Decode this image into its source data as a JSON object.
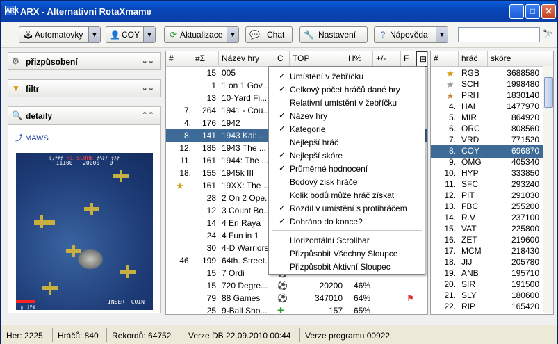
{
  "window": {
    "title": "ARX - Alternativní RotaXmame",
    "logo": "ARX"
  },
  "toolbar": {
    "automatovky": "Automatovky",
    "user": "COY",
    "aktualizace": "Aktualizace",
    "chat": "Chat",
    "nastaveni": "Nastavení",
    "napoveda": "Nápověda",
    "search_value": ""
  },
  "sidebar": {
    "prizpusobeni": "přizpůsobení",
    "filtr": "filtr",
    "detaily": "detaily",
    "maws": "MAWS",
    "screen": {
      "p1": "ﾚﾉﾁﾒﾁ",
      "hi": "HI-SCORE",
      "p2": "ﾁﾍﾚﾉ ﾁﾒﾁ",
      "s1": "11100",
      "s2": "20000",
      "s3": "0",
      "insert": "INSERT COIN",
      "bottom": "▯ ﾒﾁﾒ"
    }
  },
  "gtable": {
    "headers": [
      "#",
      "#Σ",
      "Název hry",
      "C",
      "TOP",
      "H%",
      "+/-",
      "F",
      "⊟"
    ],
    "rows": [
      {
        "rank": "",
        "total": "15",
        "name": "005",
        "top": "",
        "h": ""
      },
      {
        "rank": "",
        "total": "1",
        "name": "1 on 1 Gov...",
        "top": "",
        "h": ""
      },
      {
        "rank": "",
        "total": "13",
        "name": "10-Yard Fi...",
        "top": "",
        "h": ""
      },
      {
        "rank": "7.",
        "total": "264",
        "name": "1941 - Cou...",
        "top": "",
        "h": ""
      },
      {
        "rank": "4.",
        "total": "176",
        "name": "1942",
        "top": "",
        "h": ""
      },
      {
        "rank": "8.",
        "total": "141",
        "name": "1943 Kai: ...",
        "top": "",
        "h": ""
      },
      {
        "rank": "12.",
        "total": "185",
        "name": "1943 The ...",
        "top": "",
        "h": ""
      },
      {
        "rank": "11.",
        "total": "161",
        "name": "1944: The ...",
        "top": "",
        "h": ""
      },
      {
        "rank": "18.",
        "total": "155",
        "name": "1945k III",
        "top": "",
        "h": ""
      },
      {
        "rank": "",
        "total": "161",
        "name": "19XX: The ...",
        "top": "",
        "h": ""
      },
      {
        "rank": "",
        "total": "28",
        "name": "2 On 2 Ope...",
        "top": "",
        "h": ""
      },
      {
        "rank": "",
        "total": "12",
        "name": "3 Count Bo...",
        "top": "",
        "h": ""
      },
      {
        "rank": "",
        "total": "14",
        "name": "4 En Raya",
        "top": "",
        "h": ""
      },
      {
        "rank": "",
        "total": "24",
        "name": "4 Fun in 1",
        "top": "",
        "h": ""
      },
      {
        "rank": "",
        "total": "30",
        "name": "4-D Warriors",
        "top": "",
        "h": ""
      },
      {
        "rank": "46.",
        "total": "199",
        "name": "64th. Street...",
        "top": "",
        "h": ""
      },
      {
        "rank": "",
        "total": "15",
        "name": "7 Ordi",
        "top": "",
        "h": ""
      },
      {
        "rank": "",
        "total": "15",
        "name": "720 Degre...",
        "top": "20200",
        "h": "46%"
      },
      {
        "rank": "",
        "total": "79",
        "name": "88 Games",
        "top": "347010",
        "h": "64%"
      },
      {
        "rank": "",
        "total": "25",
        "name": "9-Ball Sho...",
        "top": "157",
        "h": "65%"
      }
    ]
  },
  "menu": [
    {
      "checked": true,
      "label": "Umístění v žebříčku"
    },
    {
      "checked": true,
      "label": "Celkový počet hráčů dané hry"
    },
    {
      "checked": false,
      "label": "Relativní umístění v žebříčku"
    },
    {
      "checked": true,
      "label": "Název hry"
    },
    {
      "checked": true,
      "label": "Kategorie"
    },
    {
      "checked": false,
      "label": "Nejlepší hráč"
    },
    {
      "checked": true,
      "label": "Nejlepší skóre"
    },
    {
      "checked": true,
      "label": "Průměrné hodnocení"
    },
    {
      "checked": false,
      "label": "Bodový zisk hráče"
    },
    {
      "checked": false,
      "label": "Kolik bodů může hráč získat"
    },
    {
      "checked": true,
      "label": "Rozdíl v umístění s protihráčem"
    },
    {
      "checked": true,
      "label": "Dohráno do konce?"
    },
    {
      "checked": false,
      "label": "Horizontální Scrollbar"
    },
    {
      "checked": false,
      "label": "Přizpůsobit Všechny Sloupce"
    },
    {
      "checked": false,
      "label": "Přizpůsobit Aktivní Sloupec"
    }
  ],
  "ptable": {
    "headers": [
      "#",
      "hráč",
      "skóre"
    ],
    "rows": [
      {
        "rank": "",
        "player": "RGB",
        "score": "3688580"
      },
      {
        "rank": "",
        "player": "SCH",
        "score": "1998480"
      },
      {
        "rank": "",
        "player": "PRH",
        "score": "1830140"
      },
      {
        "rank": "4.",
        "player": "HAI",
        "score": "1477970"
      },
      {
        "rank": "5.",
        "player": "MIR",
        "score": "864920"
      },
      {
        "rank": "6.",
        "player": "ORC",
        "score": "808560"
      },
      {
        "rank": "7.",
        "player": "VRD",
        "score": "771520"
      },
      {
        "rank": "8.",
        "player": "COY",
        "score": "696870"
      },
      {
        "rank": "9.",
        "player": "OMG",
        "score": "405340"
      },
      {
        "rank": "10.",
        "player": "HYP",
        "score": "333850"
      },
      {
        "rank": "11.",
        "player": "SFC",
        "score": "293240"
      },
      {
        "rank": "12.",
        "player": "PIT",
        "score": "291030"
      },
      {
        "rank": "13.",
        "player": "FBC",
        "score": "255200"
      },
      {
        "rank": "14.",
        "player": "R.V",
        "score": "237100"
      },
      {
        "rank": "15.",
        "player": "VAT",
        "score": "225800"
      },
      {
        "rank": "16.",
        "player": "ZET",
        "score": "219600"
      },
      {
        "rank": "17.",
        "player": "MCM",
        "score": "218430"
      },
      {
        "rank": "18.",
        "player": "JIJ",
        "score": "205780"
      },
      {
        "rank": "19.",
        "player": "ANB",
        "score": "195710"
      },
      {
        "rank": "20.",
        "player": "SIR",
        "score": "191500"
      },
      {
        "rank": "21.",
        "player": "SLY",
        "score": "180600"
      },
      {
        "rank": "22.",
        "player": "RIP",
        "score": "165420"
      }
    ]
  },
  "status": {
    "her": "Her: 2225",
    "hracu": "Hráčů: 840",
    "rekordu": "Rekordů: 64752",
    "verze_db": "Verze DB 22.09.2010 00:44",
    "verze_programu": "Verze programu 00922"
  }
}
